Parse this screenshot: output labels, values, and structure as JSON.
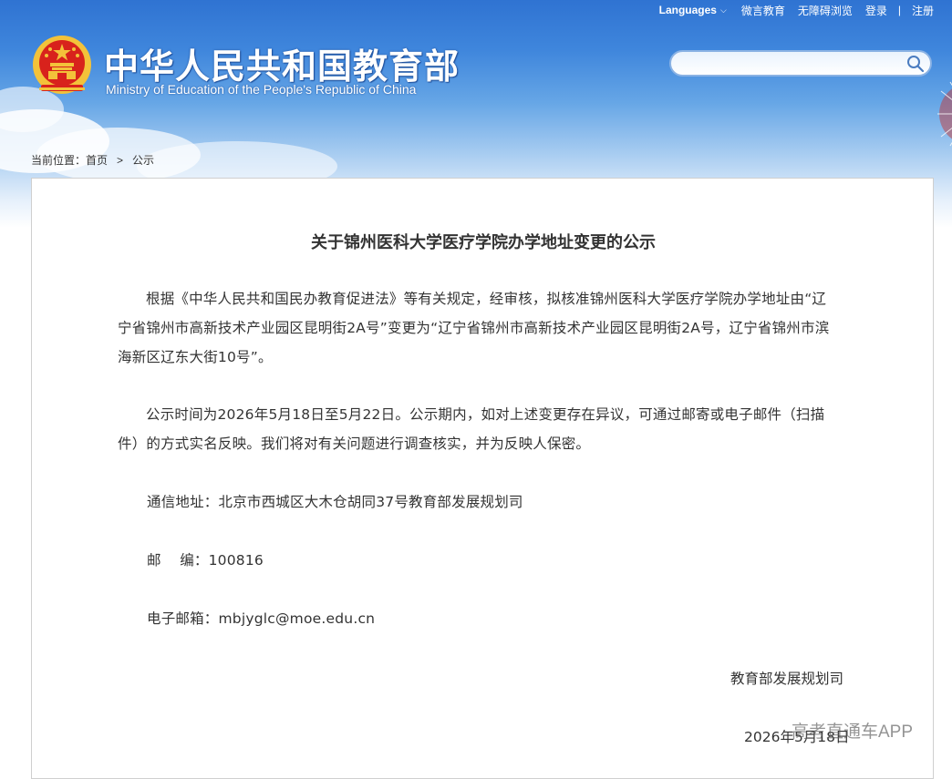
{
  "header": {
    "languages_label": "Languages",
    "links": [
      "微言教育",
      "无障碍浏览",
      "登录",
      "注册"
    ],
    "title_cn": "中华人民共和国教育部",
    "title_en": "Ministry of Education of the People's Republic of China",
    "search_placeholder": ""
  },
  "breadcrumb": {
    "prefix": "当前位置：",
    "home": "首页",
    "current": "公示"
  },
  "article": {
    "title": "关于锦州医科大学医疗学院办学地址变更的公示",
    "paragraph1": "根据《中华人民共和国民办教育促进法》等有关规定，经审核，拟核准锦州医科大学医疗学院办学地址由“辽宁省锦州市高新技术产业园区昆明街2A号”变更为“辽宁省锦州市高新技术产业园区昆明街2A号，辽宁省锦州市滨海新区辽东大街10号”。",
    "paragraph2": "公示时间为2026年5月18日至5月22日。公示期内，如对上述变更存在异议，可通过邮寄或电子邮件（扫描件）的方式实名反映。我们将对有关问题进行调查核实，并为反映人保密。",
    "address": "通信地址：北京市西城区大木仓胡同37号教育部发展规划司",
    "postcode": "邮    编：100816",
    "email": "电子邮箱：mbjyglc@moe.edu.cn",
    "signature": "教育部发展规划司",
    "date": "2026年5月18日"
  },
  "watermark": "高考直通车APP",
  "colors": {
    "banner_top": "#2f73d2",
    "text": "#333333",
    "emblem_red": "#d8221c",
    "emblem_gold": "#f3c23a"
  }
}
